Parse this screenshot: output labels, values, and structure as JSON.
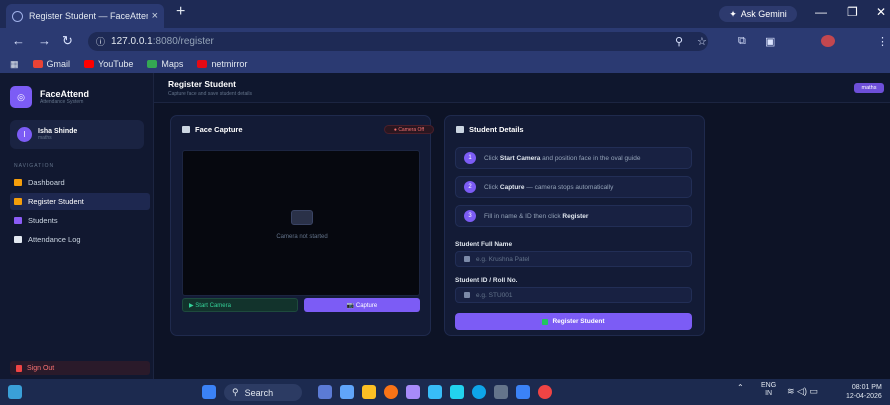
{
  "browser": {
    "tab_title": "Register Student — FaceAttend",
    "tab_close": "×",
    "new_tab": "+",
    "ask_gemini": "Ask Gemini",
    "url_host": "127.0.0.1",
    "url_path": ":8080/register",
    "bookmarks": [
      {
        "label": "Gmail",
        "color": "#ea4335"
      },
      {
        "label": "YouTube",
        "color": "#ff0000"
      },
      {
        "label": "Maps",
        "color": "#34a853"
      },
      {
        "label": "netmirror",
        "color": "#e50914"
      }
    ]
  },
  "sidebar": {
    "brand_name": "FaceAttend",
    "brand_sub": "Attendance System",
    "user_name": "Isha Shinde",
    "user_role": "maths",
    "user_initial": "I",
    "nav_label": "NAVIGATION",
    "items": [
      {
        "label": "Dashboard",
        "icon": "home-icon",
        "color": "#f59e0b"
      },
      {
        "label": "Register Student",
        "icon": "user-plus-icon",
        "color": "#f59e0b"
      },
      {
        "label": "Students",
        "icon": "users-icon",
        "color": "#8b5cf6"
      },
      {
        "label": "Attendance Log",
        "icon": "log-icon",
        "color": "#e2e8f0"
      }
    ],
    "sign_out": "Sign Out"
  },
  "header": {
    "title": "Register Student",
    "subtitle": "Capture face and save student details",
    "role_badge": "maths"
  },
  "face_capture": {
    "title": "Face Capture",
    "camera_status": "● Camera Off",
    "placeholder": "Camera not started",
    "start_button": "▶ Start Camera",
    "capture_button": "📷 Capture"
  },
  "student_details": {
    "title": "Student Details",
    "steps": [
      {
        "num": "1",
        "pre": "Click ",
        "bold": "Start Camera",
        "post": " and position face in the oval guide"
      },
      {
        "num": "2",
        "pre": "Click ",
        "bold": "Capture",
        "post": " — camera stops automatically"
      },
      {
        "num": "3",
        "pre": "Fill in name & ID then click ",
        "bold": "Register",
        "post": ""
      }
    ],
    "name_label": "Student Full Name",
    "name_placeholder": "e.g. Krushna Patel",
    "id_label": "Student ID / Roll No.",
    "id_placeholder": "e.g. STU001",
    "register_button": "Register Student"
  },
  "taskbar": {
    "search": "Search",
    "lang": "ENG",
    "region": "IN",
    "time": "08:01 PM",
    "date": "12-04-2026"
  }
}
